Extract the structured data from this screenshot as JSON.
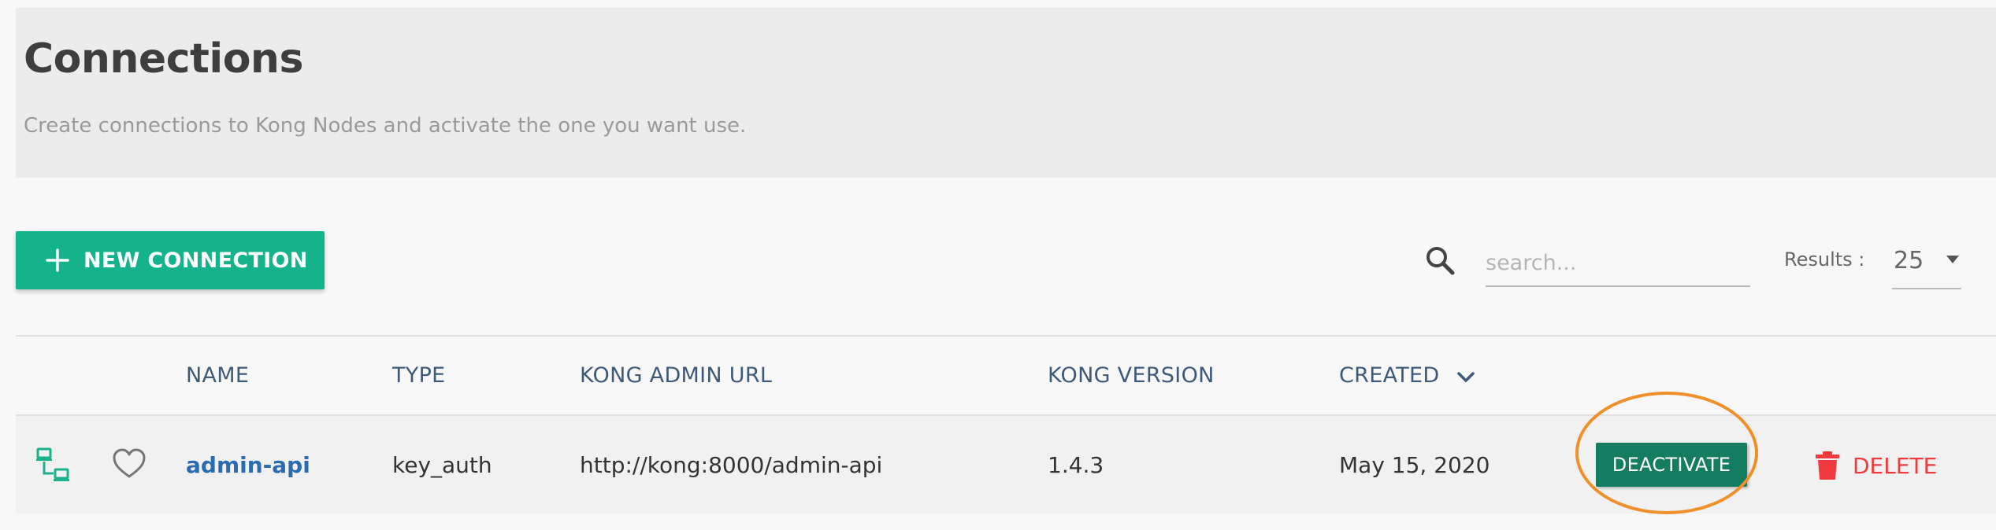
{
  "header": {
    "title": "Connections",
    "subtitle": "Create connections to Kong Nodes and activate the one you want use."
  },
  "toolbar": {
    "new_connection_label": "NEW CONNECTION",
    "search_placeholder": "search...",
    "results_label": "Results :",
    "results_value": "25"
  },
  "table": {
    "columns": {
      "name": "NAME",
      "type": "TYPE",
      "kong_admin_url": "KONG ADMIN URL",
      "kong_version": "KONG VERSION",
      "created": "CREATED"
    },
    "sort": {
      "column": "created",
      "direction": "desc"
    },
    "rows": [
      {
        "name": "admin-api",
        "type": "key_auth",
        "kong_admin_url": "http://kong:8000/admin-api",
        "kong_version": "1.4.3",
        "created": "May 15, 2020",
        "action_label": "DEACTIVATE",
        "delete_label": "DELETE",
        "active": true
      }
    ]
  },
  "icons": {
    "plus": "plus-icon",
    "search": "search-icon",
    "dropdown": "dropdown-icon",
    "sort": "chevron-down-icon",
    "status": "network-connected-icon",
    "favorite": "heart-outline-icon",
    "delete": "trash-icon"
  },
  "colors": {
    "primary": "#14b38b",
    "active_button": "#157d5f",
    "link": "#2b6cb0",
    "column_header": "#3e5a78",
    "danger": "#f03a3e",
    "highlight": "#f0902a"
  }
}
